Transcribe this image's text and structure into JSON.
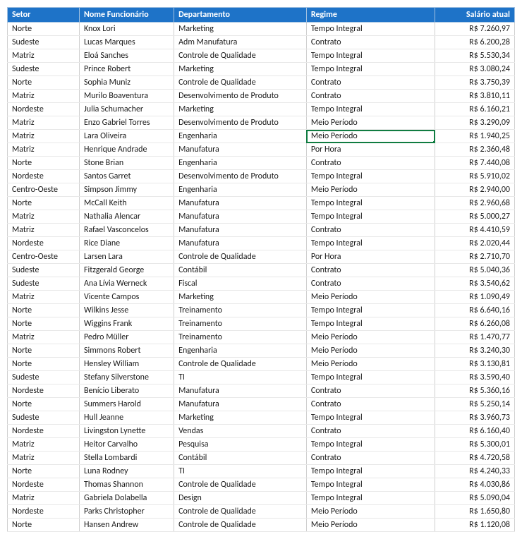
{
  "headers": {
    "setor": "Setor",
    "nome": "Nome Funcionário",
    "depto": "Departamento",
    "regime": "Regime",
    "salario": "Salário atual"
  },
  "selected_row_index": 8,
  "selected_col": "regime",
  "rows": [
    {
      "setor": "Norte",
      "nome": "Knox Lori",
      "depto": "Marketing",
      "regime": "Tempo Integral",
      "salario": "R$ 7.260,97"
    },
    {
      "setor": "Sudeste",
      "nome": "Lucas Marques",
      "depto": "Adm Manufatura",
      "regime": "Contrato",
      "salario": "R$ 6.200,28"
    },
    {
      "setor": "Matriz",
      "nome": "Eloá Sanches",
      "depto": "Controle de Qualidade",
      "regime": "Tempo Integral",
      "salario": "R$ 5.530,34"
    },
    {
      "setor": "Sudeste",
      "nome": "Prince Robert",
      "depto": "Marketing",
      "regime": "Tempo Integral",
      "salario": "R$ 3.080,24"
    },
    {
      "setor": "Norte",
      "nome": "Sophia Muniz",
      "depto": "Controle de Qualidade",
      "regime": "Contrato",
      "salario": "R$ 3.750,39"
    },
    {
      "setor": "Matriz",
      "nome": "Murilo Boaventura",
      "depto": "Desenvolvimento de Produto",
      "regime": "Contrato",
      "salario": "R$ 3.810,11"
    },
    {
      "setor": "Nordeste",
      "nome": "Julia Schumacher",
      "depto": "Marketing",
      "regime": "Tempo Integral",
      "salario": "R$ 6.160,21"
    },
    {
      "setor": "Matriz",
      "nome": "Enzo Gabriel Torres",
      "depto": "Desenvolvimento de Produto",
      "regime": "Meio Período",
      "salario": "R$ 3.290,09"
    },
    {
      "setor": "Matriz",
      "nome": "Lara Oliveira",
      "depto": "Engenharia",
      "regime": "Meio Período",
      "salario": "R$ 1.940,25"
    },
    {
      "setor": "Matriz",
      "nome": "Henrique Andrade",
      "depto": "Manufatura",
      "regime": "Por Hora",
      "salario": "R$ 2.360,48"
    },
    {
      "setor": "Norte",
      "nome": "Stone Brian",
      "depto": "Engenharia",
      "regime": "Contrato",
      "salario": "R$ 7.440,08"
    },
    {
      "setor": "Nordeste",
      "nome": "Santos Garret",
      "depto": "Desenvolvimento de Produto",
      "regime": "Tempo Integral",
      "salario": "R$ 5.910,02"
    },
    {
      "setor": "Centro-Oeste",
      "nome": "Simpson Jimmy",
      "depto": "Engenharia",
      "regime": "Meio Período",
      "salario": "R$ 2.940,00"
    },
    {
      "setor": "Norte",
      "nome": "McCall Keith",
      "depto": "Manufatura",
      "regime": "Tempo Integral",
      "salario": "R$ 2.960,68"
    },
    {
      "setor": "Matriz",
      "nome": "Nathalia Alencar",
      "depto": "Manufatura",
      "regime": "Tempo Integral",
      "salario": "R$ 5.000,27"
    },
    {
      "setor": "Matriz",
      "nome": "Rafael Vasconcelos",
      "depto": "Manufatura",
      "regime": "Contrato",
      "salario": "R$ 4.410,59"
    },
    {
      "setor": "Nordeste",
      "nome": "Rice Diane",
      "depto": "Manufatura",
      "regime": "Tempo Integral",
      "salario": "R$ 2.020,44"
    },
    {
      "setor": "Centro-Oeste",
      "nome": "Larsen Lara",
      "depto": "Controle de Qualidade",
      "regime": "Por Hora",
      "salario": "R$ 2.710,70"
    },
    {
      "setor": "Sudeste",
      "nome": "Fitzgerald George",
      "depto": "Contábil",
      "regime": "Contrato",
      "salario": "R$ 5.040,36"
    },
    {
      "setor": "Sudeste",
      "nome": "Ana Lívia Werneck",
      "depto": "Fiscal",
      "regime": "Contrato",
      "salario": "R$ 3.540,62"
    },
    {
      "setor": "Matriz",
      "nome": "Vicente Campos",
      "depto": "Marketing",
      "regime": "Meio Período",
      "salario": "R$ 1.090,49"
    },
    {
      "setor": "Norte",
      "nome": "Wilkins Jesse",
      "depto": "Treinamento",
      "regime": "Tempo Integral",
      "salario": "R$ 6.640,16"
    },
    {
      "setor": "Norte",
      "nome": "Wiggins Frank",
      "depto": "Treinamento",
      "regime": "Tempo Integral",
      "salario": "R$ 6.260,08"
    },
    {
      "setor": "Matriz",
      "nome": "Pedro Müller",
      "depto": "Treinamento",
      "regime": "Meio Período",
      "salario": "R$ 1.470,77"
    },
    {
      "setor": "Norte",
      "nome": "Simmons Robert",
      "depto": "Engenharia",
      "regime": "Meio Período",
      "salario": "R$ 3.240,30"
    },
    {
      "setor": "Norte",
      "nome": "Hensley William",
      "depto": "Controle de Qualidade",
      "regime": "Meio Período",
      "salario": "R$ 3.130,81"
    },
    {
      "setor": "Sudeste",
      "nome": "Stefany Silverstone",
      "depto": "TI",
      "regime": "Tempo Integral",
      "salario": "R$ 3.590,40"
    },
    {
      "setor": "Nordeste",
      "nome": "Benício Liberato",
      "depto": "Manufatura",
      "regime": "Contrato",
      "salario": "R$ 5.360,16"
    },
    {
      "setor": "Norte",
      "nome": "Summers Harold",
      "depto": "Manufatura",
      "regime": "Contrato",
      "salario": "R$ 5.250,14"
    },
    {
      "setor": "Sudeste",
      "nome": "Hull Jeanne",
      "depto": "Marketing",
      "regime": "Tempo Integral",
      "salario": "R$ 3.960,73"
    },
    {
      "setor": "Nordeste",
      "nome": "Livingston Lynette",
      "depto": "Vendas",
      "regime": "Contrato",
      "salario": "R$ 6.160,40"
    },
    {
      "setor": "Matriz",
      "nome": "Heitor Carvalho",
      "depto": "Pesquisa",
      "regime": "Tempo Integral",
      "salario": "R$ 5.300,01"
    },
    {
      "setor": "Matriz",
      "nome": "Stella Lombardi",
      "depto": "Contábil",
      "regime": "Contrato",
      "salario": "R$ 4.720,58"
    },
    {
      "setor": "Norte",
      "nome": "Luna Rodney",
      "depto": "TI",
      "regime": "Tempo Integral",
      "salario": "R$ 4.240,33"
    },
    {
      "setor": "Nordeste",
      "nome": "Thomas Shannon",
      "depto": "Controle de Qualidade",
      "regime": "Tempo Integral",
      "salario": "R$ 4.030,86"
    },
    {
      "setor": "Matriz",
      "nome": "Gabriela Dolabella",
      "depto": "Design",
      "regime": "Tempo Integral",
      "salario": "R$ 5.090,04"
    },
    {
      "setor": "Nordeste",
      "nome": "Parks Christopher",
      "depto": "Controle de Qualidade",
      "regime": "Meio Período",
      "salario": "R$ 1.650,80"
    },
    {
      "setor": "Norte",
      "nome": "Hansen Andrew",
      "depto": "Controle de Qualidade",
      "regime": "Meio Período",
      "salario": "R$ 1.120,08"
    }
  ]
}
